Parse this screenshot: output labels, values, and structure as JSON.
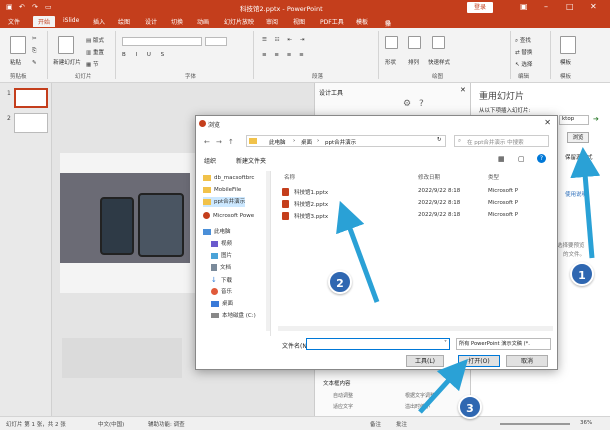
{
  "window": {
    "title": "科技馆2.pptx - PowerPoint",
    "login": "登录"
  },
  "tabs": [
    "文件",
    "开始",
    "iSlide",
    "插入",
    "绘图",
    "设计",
    "切换",
    "动画",
    "幻灯片放映",
    "审阅",
    "视图",
    "PDF工具",
    "模板",
    "操作说明搜索"
  ],
  "ribbon": {
    "clipboard": {
      "paste": "粘贴",
      "group": "剪贴板"
    },
    "slides": {
      "new_slide": "新建幻灯片",
      "layout": "版式",
      "reset": "重置",
      "section": "节",
      "group": "幻灯片"
    },
    "font": {
      "group": "字体"
    },
    "paragraph": {
      "group": "段落"
    },
    "drawing": {
      "shapes": "形状",
      "arrange": "排列",
      "quick_styles": "快速样式",
      "group": "绘图"
    },
    "editing": {
      "find": "查找",
      "replace": "替换",
      "select": "选择",
      "group": "编辑"
    },
    "template": {
      "label": "模板",
      "group": "模板"
    }
  },
  "slides_panel": {
    "items": [
      "1",
      "2"
    ]
  },
  "design_panel": {
    "title": "设计工具",
    "section": "文本框内容",
    "opt1": "自动调整",
    "opt2": "适应文字",
    "opt3": "根据文字调整",
    "opt4": "溢出时缩小"
  },
  "reuse_panel": {
    "title": "重用幻灯片",
    "subtitle": "从以下项插入幻灯片:",
    "dropdown": "ktop",
    "browse": "浏览",
    "keep_source": "保留源格式",
    "link": "使用说明",
    "hint1": "选择要预览",
    "hint2": "的文件。"
  },
  "dialog": {
    "title": "浏览",
    "breadcrumb": [
      "此电脑",
      "桌面",
      "ppt合并演示"
    ],
    "search_placeholder": "在 ppt合并演示 中搜索",
    "organize": "组织",
    "new_folder": "新建文件夹",
    "nav": [
      {
        "label": "db_macsoftbrc",
        "icon": "folder-icon"
      },
      {
        "label": "MobileFile",
        "icon": "folder-icon"
      },
      {
        "label": "ppt合并演示",
        "icon": "folder-icon"
      },
      {
        "label": "Microsoft Powe",
        "icon": "powerpoint-icon"
      },
      {
        "label": "此电脑",
        "icon": "computer-icon"
      },
      {
        "label": "视频",
        "icon": "video-icon"
      },
      {
        "label": "图片",
        "icon": "picture-icon"
      },
      {
        "label": "文档",
        "icon": "document-icon"
      },
      {
        "label": "下载",
        "icon": "download-icon"
      },
      {
        "label": "音乐",
        "icon": "music-icon"
      },
      {
        "label": "桌面",
        "icon": "desktop-icon"
      },
      {
        "label": "本地磁盘 (C:)",
        "icon": "disk-icon"
      }
    ],
    "columns": [
      "名称",
      "修改日期",
      "类型"
    ],
    "files": [
      {
        "name": "科技馆1.pptx",
        "date": "2022/9/22 8:18",
        "type": "Microsoft P"
      },
      {
        "name": "科技馆2.pptx",
        "date": "2022/9/22 8:18",
        "type": "Microsoft P"
      },
      {
        "name": "科技馆3.pptx",
        "date": "2022/9/22 8:18",
        "type": "Microsoft P"
      }
    ],
    "filename_label": "文件名(N):",
    "filename_value": "",
    "filetype": "所有 PowerPoint 演示文稿 (*.",
    "tools": "工具(L)",
    "open": "打开(O)",
    "cancel": "取消"
  },
  "status": {
    "slide": "幻灯片 第 1 张，共 2 张",
    "lang": "中文(中国)",
    "access": "辅助功能: 调查",
    "notes": "备注",
    "comments": "批注",
    "zoom": "36%"
  },
  "callouts": [
    "1",
    "2",
    "3"
  ],
  "colors": {
    "accent": "#c43e1c",
    "callout": "#2f67b1",
    "arrow": "#2aa1d6"
  }
}
